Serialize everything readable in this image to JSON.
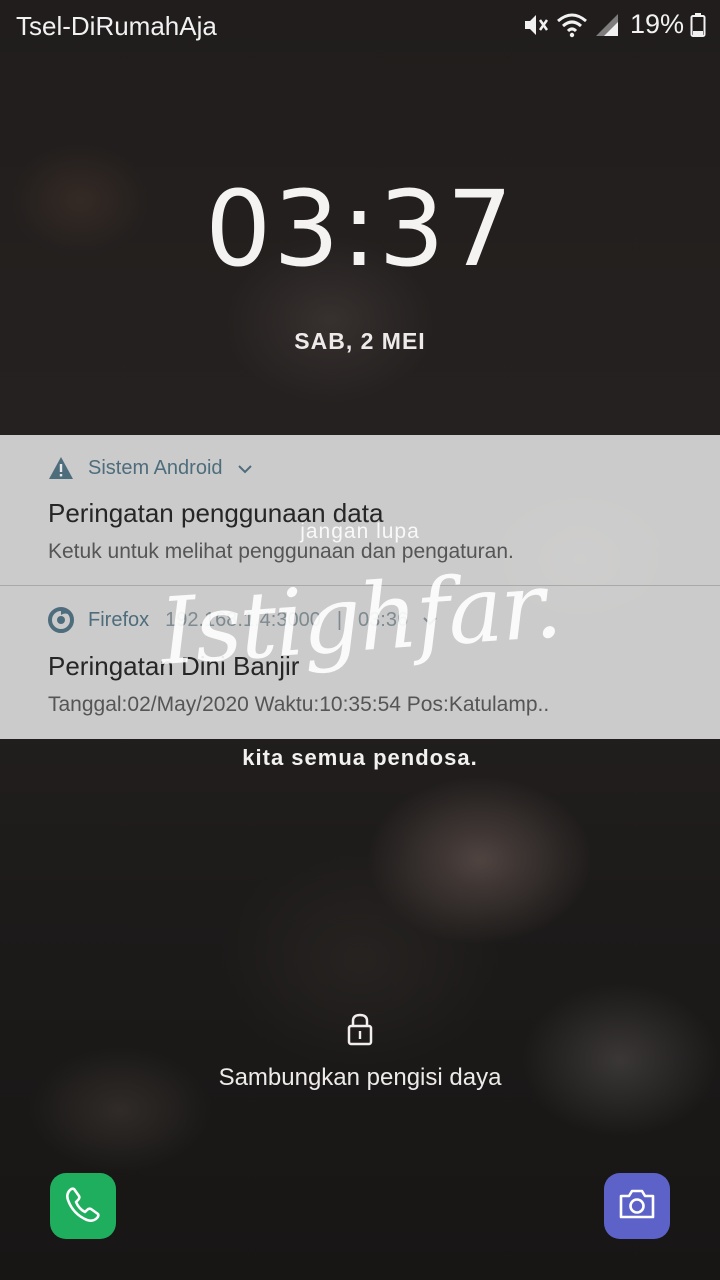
{
  "status_bar": {
    "carrier": "Tsel-DiRumahAja",
    "battery_percent": "19%",
    "icons": [
      "mute-icon",
      "wifi-icon",
      "signal-icon",
      "battery-icon"
    ]
  },
  "lock_screen": {
    "clock": "03:37",
    "date": "SAB, 2 MEI",
    "lock_icon": "lock-icon",
    "charge_hint": "Sambungkan pengisi daya"
  },
  "notifications": [
    {
      "app": "Sistem Android",
      "icon": "warning-icon",
      "title": "Peringatan penggunaan data",
      "text": "Ketuk untuk melihat penggunaan dan pengaturan."
    },
    {
      "app": "Firefox",
      "icon": "firefox-icon",
      "source": "192.168.1.4:3000",
      "time": "03:36",
      "title": "Peringatan Dini Banjir",
      "text": "Tanggal:02/May/2020 Waktu:10:35:54 Pos:Katulamp.."
    }
  ],
  "wallpaper_text": {
    "top": "jangan lupa",
    "script": "Istighfar.",
    "bottom": "kita semua pendosa."
  },
  "shortcuts": {
    "left": "phone-icon",
    "right": "camera-icon"
  },
  "colors": {
    "phone_shortcut": "#1fae5d",
    "camera_shortcut": "#5d62c8",
    "notification_accent": "#4e6d7c"
  }
}
